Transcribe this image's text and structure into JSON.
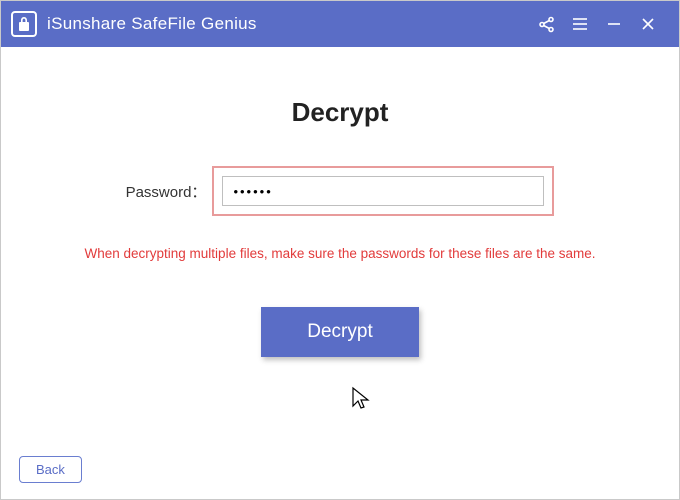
{
  "titlebar": {
    "app_title": "iSunshare SafeFile Genius"
  },
  "main": {
    "heading": "Decrypt",
    "password_label": "Password：",
    "password_value": "••••••",
    "password_placeholder": "",
    "warning_text": "When decrypting multiple files, make sure the passwords for these files are the same.",
    "decrypt_button_label": "Decrypt"
  },
  "footer": {
    "back_label": "Back"
  },
  "colors": {
    "accent": "#5a6dc6",
    "highlight_border": "#e89b9b",
    "error_text": "#e23b3b"
  }
}
